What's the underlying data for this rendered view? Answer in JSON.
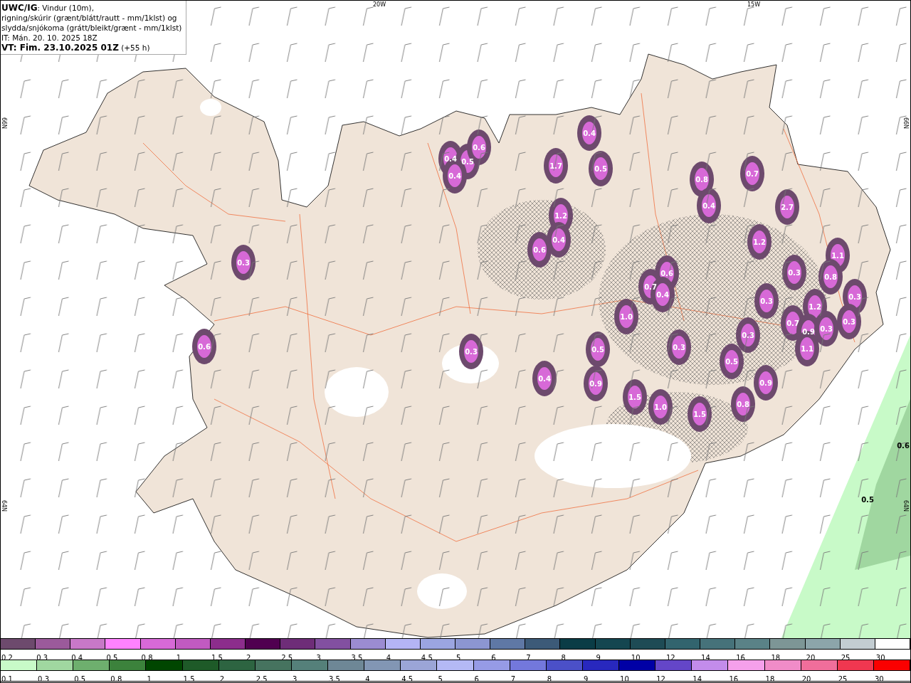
{
  "header": {
    "lines": [
      "**UWC/IG**: Vindur (10m),",
      "rigning/skúrir (grænt/blátt/rautt - mm/1klst) og",
      "slydda/snjókoma (grátt/bleikt/grænt - mm/1klst)",
      "IT: Mán. 20. 10. 2025 18Z",
      "**VT: Fim. 23.10.2025 01Z** (+55 h)"
    ]
  },
  "map": {
    "longitude_labels": [
      "20W",
      "15W"
    ],
    "latitude_labels_left": [
      "66N",
      "64N"
    ],
    "latitude_labels_right": [
      "66N",
      "64N"
    ],
    "value_labels": [
      {
        "text": "0.4",
        "kind": "snow"
      },
      {
        "text": "0.4",
        "kind": "snow"
      },
      {
        "text": "0.5",
        "kind": "snow"
      },
      {
        "text": "0.6",
        "kind": "snow"
      },
      {
        "text": "0.4",
        "kind": "snow"
      },
      {
        "text": "1.7",
        "kind": "snow"
      },
      {
        "text": "0.5",
        "kind": "snow"
      },
      {
        "text": "0.8",
        "kind": "snow"
      },
      {
        "text": "0.7",
        "kind": "snow"
      },
      {
        "text": "0.4",
        "kind": "snow"
      },
      {
        "text": "2.7",
        "kind": "snow"
      },
      {
        "text": "1.2",
        "kind": "snow"
      },
      {
        "text": "0.4",
        "kind": "snow"
      },
      {
        "text": "0.6",
        "kind": "snow"
      },
      {
        "text": "1.2",
        "kind": "snow"
      },
      {
        "text": "0.3",
        "kind": "snow"
      },
      {
        "text": "0.6",
        "kind": "snow"
      },
      {
        "text": "0.3",
        "kind": "snow"
      },
      {
        "text": "1.1",
        "kind": "snow"
      },
      {
        "text": "0.8",
        "kind": "snow"
      },
      {
        "text": "0.3",
        "kind": "snow"
      },
      {
        "text": "0.7",
        "kind": "snow"
      },
      {
        "text": "0.4",
        "kind": "snow"
      },
      {
        "text": "0.3",
        "kind": "snow"
      },
      {
        "text": "1.2",
        "kind": "snow"
      },
      {
        "text": "1.0",
        "kind": "snow"
      },
      {
        "text": "0.7",
        "kind": "snow"
      },
      {
        "text": "0.9",
        "kind": "snow"
      },
      {
        "text": "0.3",
        "kind": "snow"
      },
      {
        "text": "0.3",
        "kind": "snow"
      },
      {
        "text": "0.3",
        "kind": "snow"
      },
      {
        "text": "0.6",
        "kind": "snow"
      },
      {
        "text": "0.3",
        "kind": "snow"
      },
      {
        "text": "0.5",
        "kind": "snow"
      },
      {
        "text": "0.3",
        "kind": "snow"
      },
      {
        "text": "0.5",
        "kind": "snow"
      },
      {
        "text": "1.1",
        "kind": "snow"
      },
      {
        "text": "0.4",
        "kind": "snow"
      },
      {
        "text": "0.9",
        "kind": "snow"
      },
      {
        "text": "0.9",
        "kind": "snow"
      },
      {
        "text": "1.5",
        "kind": "snow"
      },
      {
        "text": "1.0",
        "kind": "snow"
      },
      {
        "text": "1.5",
        "kind": "snow"
      },
      {
        "text": "0.8",
        "kind": "snow"
      },
      {
        "text": "0.6",
        "kind": "rain"
      },
      {
        "text": "0.5",
        "kind": "rain"
      }
    ]
  },
  "legend": {
    "snow": [
      {
        "label": "0.2",
        "color": "#6d4a6d"
      },
      {
        "label": "0.3",
        "color": "#9b5a9b"
      },
      {
        "label": "0.4",
        "color": "#c878c8"
      },
      {
        "label": "0.5",
        "color": "#ff82ff"
      },
      {
        "label": "0.8",
        "color": "#d769d7"
      },
      {
        "label": "1",
        "color": "#c15ac1"
      },
      {
        "label": "1.5",
        "color": "#8c2d8c"
      },
      {
        "label": "2",
        "color": "#500050"
      },
      {
        "label": "2.5",
        "color": "#6e2d78"
      },
      {
        "label": "3",
        "color": "#8250a0"
      },
      {
        "label": "3.5",
        "color": "#9b8cd2"
      },
      {
        "label": "4",
        "color": "#b4b4f5"
      },
      {
        "label": "4.5",
        "color": "#9ba5e1"
      },
      {
        "label": "5",
        "color": "#8c96d2"
      },
      {
        "label": "6",
        "color": "#5f78a5"
      },
      {
        "label": "7",
        "color": "#3c5a78"
      },
      {
        "label": "8",
        "color": "#0a3c46"
      },
      {
        "label": "9",
        "color": "#144650"
      },
      {
        "label": "10",
        "color": "#1e4b55"
      },
      {
        "label": "12",
        "color": "#32646e"
      },
      {
        "label": "14",
        "color": "#46727a"
      },
      {
        "label": "16",
        "color": "#5a8287"
      },
      {
        "label": "18",
        "color": "#7d9696"
      },
      {
        "label": "20",
        "color": "#8ca5aa"
      },
      {
        "label": "25",
        "color": "#c3cdd2"
      },
      {
        "label": "30",
        "color": "#ffffff"
      }
    ],
    "rain": [
      {
        "label": "0.1",
        "color": "#c8fac8"
      },
      {
        "label": "0.3",
        "color": "#a0d7a0"
      },
      {
        "label": "0.5",
        "color": "#6eaf6e"
      },
      {
        "label": "0.8",
        "color": "#3c823c"
      },
      {
        "label": "1",
        "color": "#004600"
      },
      {
        "label": "1.5",
        "color": "#1e5a28"
      },
      {
        "label": "2",
        "color": "#2d6441"
      },
      {
        "label": "2.5",
        "color": "#46735f"
      },
      {
        "label": "3",
        "color": "#55807a"
      },
      {
        "label": "3.5",
        "color": "#6e8796"
      },
      {
        "label": "4",
        "color": "#8296b4"
      },
      {
        "label": "4.5",
        "color": "#9ba5d7"
      },
      {
        "label": "5",
        "color": "#b4b9f5"
      },
      {
        "label": "6",
        "color": "#969be6"
      },
      {
        "label": "7",
        "color": "#7378dc"
      },
      {
        "label": "8",
        "color": "#4b50c8"
      },
      {
        "label": "9",
        "color": "#2828be"
      },
      {
        "label": "10",
        "color": "#0000a5"
      },
      {
        "label": "12",
        "color": "#6446c8"
      },
      {
        "label": "14",
        "color": "#c38ceb"
      },
      {
        "label": "16",
        "color": "#f5a0eb"
      },
      {
        "label": "18",
        "color": "#f08cc8"
      },
      {
        "label": "20",
        "color": "#f06e9b"
      },
      {
        "label": "25",
        "color": "#f03750"
      },
      {
        "label": "30",
        "color": "#fa0000"
      }
    ]
  }
}
